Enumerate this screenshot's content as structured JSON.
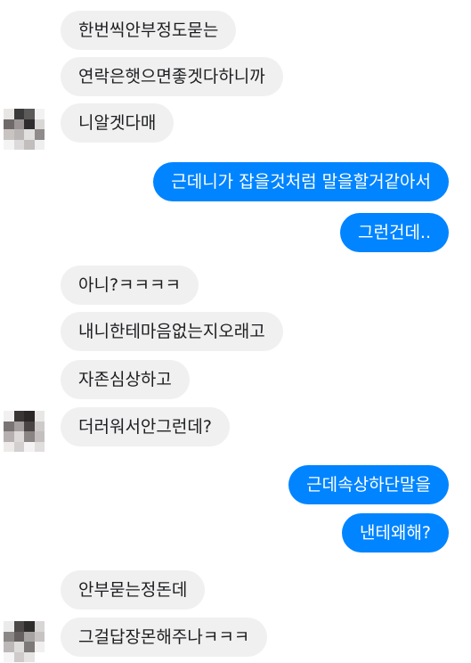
{
  "messages": [
    {
      "text": "한번씩안부정도묻는",
      "side": "in"
    },
    {
      "text": "연락은햇으면좋겟다하니까",
      "side": "in"
    },
    {
      "text": "니알겟다매",
      "side": "in"
    },
    {
      "text": "근데니가 잡을것처럼 말을할거같아서",
      "side": "out"
    },
    {
      "text": "그런건데..",
      "side": "out"
    },
    {
      "text": "아니?ㅋㅋㅋㅋ",
      "side": "in"
    },
    {
      "text": "내니한테마음없는지오래고",
      "side": "in"
    },
    {
      "text": "자존심상하고",
      "side": "in"
    },
    {
      "text": "더러워서안그런데?",
      "side": "in"
    },
    {
      "text": "근데속상하단말을",
      "side": "out"
    },
    {
      "text": "낸테왜해?",
      "side": "out"
    },
    {
      "text": "안부묻는정돈데",
      "side": "in"
    },
    {
      "text": "그걸답장몬해주나ㅋㅋㅋ",
      "side": "in"
    }
  ],
  "colors": {
    "outgoing_bubble": "#0084ff",
    "incoming_bubble": "#f1f0f0",
    "incoming_text": "#1c1e21",
    "outgoing_text": "#ffffff"
  }
}
